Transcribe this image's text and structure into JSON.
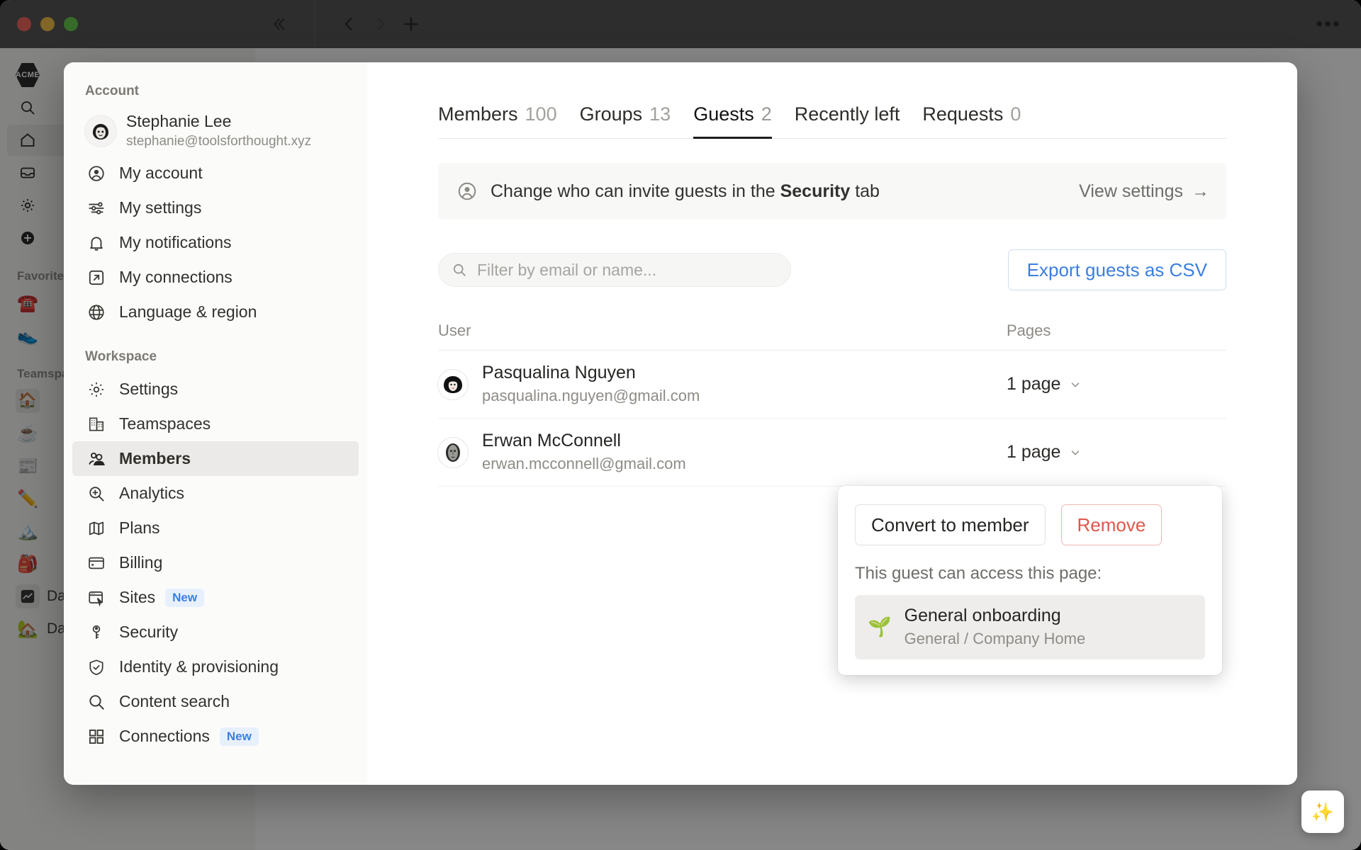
{
  "titlebar": {
    "collapse_icon": "chevrons-left-icon",
    "back_icon": "chevron-left-icon",
    "forward_icon": "chevron-right-icon",
    "new_tab_icon": "plus-icon",
    "more_icon": "ellipsis-icon",
    "more_label": "•••"
  },
  "app_sidebar": {
    "logo_label": "ACME",
    "items": [
      {
        "label": "",
        "icon": "search-icon"
      },
      {
        "label": "",
        "icon": "home-icon"
      },
      {
        "label": "",
        "icon": "inbox-icon"
      },
      {
        "label": "",
        "icon": "gear-icon"
      },
      {
        "label": "",
        "icon": "plus-circle-icon"
      }
    ],
    "favorites_label": "Favorites",
    "favorites": [
      {
        "label": "",
        "icon": "telephone-emoji",
        "glyph": "☎️"
      },
      {
        "label": "",
        "icon": "shoe-emoji",
        "glyph": "👟"
      }
    ],
    "teamspaces_label": "Teamspaces",
    "teamspaces": [
      {
        "label": "",
        "icon": "house-emoji",
        "glyph": "🏠"
      },
      {
        "label": "",
        "icon": "coffee-emoji",
        "glyph": "☕"
      },
      {
        "label": "",
        "icon": "newspaper-emoji",
        "glyph": "📰"
      },
      {
        "label": "",
        "icon": "pencil-emoji",
        "glyph": "✏️"
      },
      {
        "label": "",
        "icon": "mountain-emoji",
        "glyph": "🏔️"
      },
      {
        "label": "",
        "icon": "backpack-emoji",
        "glyph": "🎒"
      }
    ],
    "data_label": "Data",
    "data_icon": "chart-icon",
    "data_home_label": "Data Home",
    "data_home_icon": "house-tree-emoji",
    "data_home_glyph": "🏡"
  },
  "modal_nav": {
    "account_section": "Account",
    "account": {
      "name": "Stephanie Lee",
      "email": "stephanie@toolsforthought.xyz",
      "avatar_icon": "user-avatar",
      "avatar_glyph": "👩🏻"
    },
    "account_items": [
      {
        "label": "My account",
        "icon": "person-circle-icon"
      },
      {
        "label": "My settings",
        "icon": "sliders-icon"
      },
      {
        "label": "My notifications",
        "icon": "bell-icon"
      },
      {
        "label": "My connections",
        "icon": "arrow-out-icon"
      },
      {
        "label": "Language & region",
        "icon": "globe-icon"
      }
    ],
    "workspace_section": "Workspace",
    "workspace_items": [
      {
        "label": "Settings",
        "icon": "gear-icon",
        "badge": ""
      },
      {
        "label": "Teamspaces",
        "icon": "buildings-icon",
        "badge": ""
      },
      {
        "label": "Members",
        "icon": "people-icon",
        "badge": "",
        "selected": true
      },
      {
        "label": "Analytics",
        "icon": "magnify-plus-icon",
        "badge": ""
      },
      {
        "label": "Plans",
        "icon": "map-icon",
        "badge": ""
      },
      {
        "label": "Billing",
        "icon": "credit-card-icon",
        "badge": ""
      },
      {
        "label": "Sites",
        "icon": "window-cursor-icon",
        "badge": "New"
      },
      {
        "label": "Security",
        "icon": "key-icon",
        "badge": ""
      },
      {
        "label": "Identity & provisioning",
        "icon": "shield-check-icon",
        "badge": ""
      },
      {
        "label": "Content search",
        "icon": "search-icon",
        "badge": ""
      },
      {
        "label": "Connections",
        "icon": "grid-icon",
        "badge": "New"
      }
    ]
  },
  "main": {
    "tabs": [
      {
        "label": "Members",
        "count": "100",
        "active": false
      },
      {
        "label": "Groups",
        "count": "13",
        "active": false
      },
      {
        "label": "Guests",
        "count": "2",
        "active": true
      },
      {
        "label": "Recently left",
        "count": "",
        "active": false
      },
      {
        "label": "Requests",
        "count": "0",
        "active": false
      }
    ],
    "banner": {
      "icon": "person-circle-icon",
      "text_before": "Change who can invite guests in the ",
      "text_bold": "Security",
      "text_after": " tab",
      "link_label": "View settings",
      "link_arrow": "→"
    },
    "search": {
      "icon": "search-icon",
      "placeholder": "Filter by email or name...",
      "value": ""
    },
    "export_label": "Export guests as CSV",
    "table": {
      "columns": [
        "User",
        "Pages"
      ],
      "rows": [
        {
          "name": "Pasqualina Nguyen",
          "email": "pasqualina.nguyen@gmail.com",
          "avatar_glyph": "👩🏻‍🦱",
          "pages": "1 page"
        },
        {
          "name": "Erwan McConnell",
          "email": "erwan.mcconnell@gmail.com",
          "avatar_glyph": "🗿",
          "pages": "1 page"
        }
      ]
    }
  },
  "popover": {
    "convert_label": "Convert to member",
    "remove_label": "Remove",
    "caption": "This guest can access this page:",
    "page": {
      "emoji": "🌱",
      "title": "General onboarding",
      "path": "General / Company Home"
    }
  },
  "fab": {
    "icon": "sparkle-icon",
    "glyph": "✨"
  },
  "colors": {
    "accent_blue": "#3b7fe0",
    "danger_red": "#e0564c",
    "badge_bg": "#e7f0fd",
    "selected_bg": "#ebeae8",
    "titlebar": "#4a4a4a"
  }
}
